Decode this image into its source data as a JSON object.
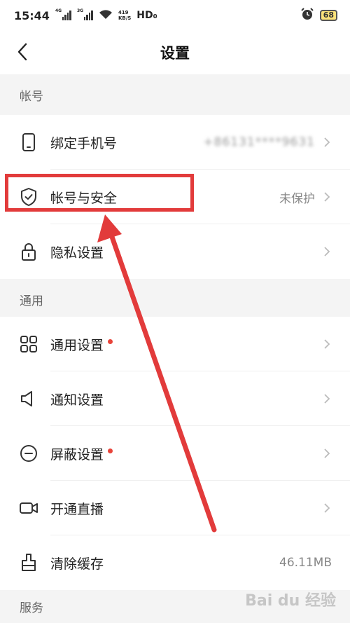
{
  "status_bar": {
    "time": "15:44",
    "network_1": "4G",
    "network_2": "3G",
    "speed_value": "419",
    "speed_unit": "KB/S",
    "hd": "HD₀",
    "battery": "68"
  },
  "nav": {
    "title": "设置"
  },
  "sections": [
    {
      "header": "帐号",
      "rows": [
        {
          "label": "绑定手机号",
          "icon": "phone-icon",
          "value": "+86131****9631"
        },
        {
          "label": "帐号与安全",
          "icon": "shield-check-icon",
          "value": "未保护"
        },
        {
          "label": "隐私设置",
          "icon": "lock-icon",
          "value": ""
        }
      ]
    },
    {
      "header": "通用",
      "rows": [
        {
          "label": "通用设置",
          "icon": "grid-icon",
          "value": "",
          "badge_dot": true
        },
        {
          "label": "通知设置",
          "icon": "speaker-icon",
          "value": ""
        },
        {
          "label": "屏蔽设置",
          "icon": "block-icon",
          "value": "",
          "badge_dot": true
        },
        {
          "label": "开通直播",
          "icon": "video-camera-icon",
          "value": ""
        },
        {
          "label": "清除缓存",
          "icon": "broom-icon",
          "value": "46.11MB"
        }
      ]
    },
    {
      "header": "服务",
      "rows": []
    }
  ],
  "watermark": "Bai du 经验",
  "colors": {
    "annotation_red": "#e23b3b",
    "section_bg": "#f4f4f4",
    "badge_dot": "#e8443a"
  }
}
